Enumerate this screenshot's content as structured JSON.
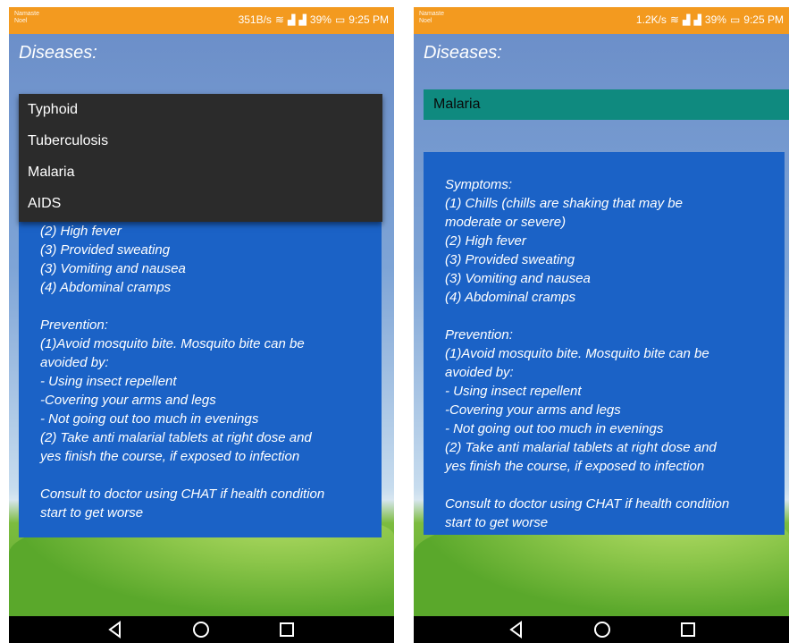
{
  "status_left": {
    "carrier_top": "Namaste",
    "carrier_bottom": "Noel",
    "speed": "351B/s",
    "battery": "39%",
    "time": "9:25 PM"
  },
  "status_right": {
    "carrier_top": "Namaste",
    "carrier_bottom": "Noel",
    "speed": "1.2K/s",
    "battery": "39%",
    "time": "9:25 PM"
  },
  "screen_title": "Diseases:",
  "dropdown_options": [
    "Typhoid",
    "Tuberculosis",
    "Malaria",
    "AIDS"
  ],
  "selected_disease": "Malaria",
  "symptoms_heading": "Symptoms:",
  "symptoms": {
    "s1_line1": "(1) Chills (chills are shaking that may be",
    "s1_line2": "moderate or severe)",
    "s2": "(2) High fever",
    "s3": "(3) Provided sweating",
    "s4": "(3) Vomiting and nausea",
    "s5": "(4) Abdominal cramps"
  },
  "prevention_heading": "Prevention:",
  "prevention": {
    "p1_line1": "(1)Avoid mosquito bite. Mosquito bite can be",
    "p1_line2": "avoided by:",
    "p2": "- Using insect repellent",
    "p3": "-Covering your arms and legs",
    "p4": "- Not going out too much in evenings",
    "p5_line1": "(2) Take anti malarial tablets at right dose and",
    "p5_line2": "yes finish the course, if exposed to infection"
  },
  "consult": {
    "line1": "Consult to doctor using CHAT if health condition",
    "line2": "start to get worse"
  },
  "icons": {
    "wifi": "wifi-icon",
    "signal": "signal-icon",
    "battery": "battery-icon",
    "back": "back-triangle-icon",
    "home": "home-circle-icon",
    "recents": "recents-square-icon"
  },
  "colors": {
    "status_bar": "#f39a1f",
    "panel": "#1b62c6",
    "selected_bar": "#0f8a7f",
    "dropdown": "#2b2b2b"
  }
}
